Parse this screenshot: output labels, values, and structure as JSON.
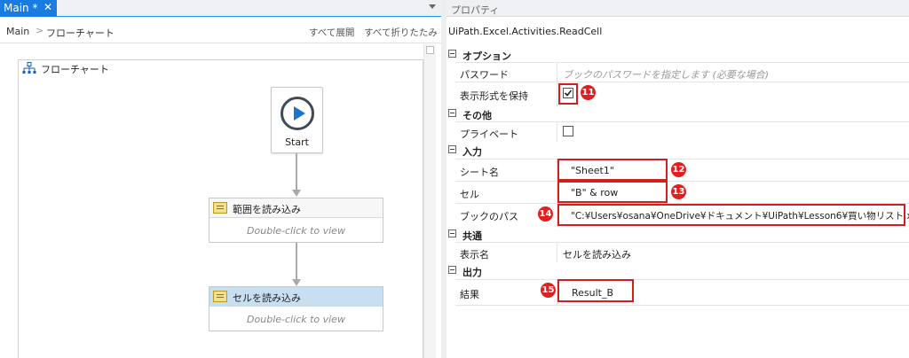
{
  "designer": {
    "tab_label": "Main *",
    "tab_close": "✕",
    "breadcrumb": {
      "main": "Main",
      "separator": ">",
      "current": "フローチャート"
    },
    "expand_all": "すべて展開",
    "collapse_all": "すべて折りたたみ",
    "flowchart_title": "フローチャート",
    "start_label": "Start",
    "activities": [
      {
        "title": "範囲を読み込み",
        "body": "Double-click to view"
      },
      {
        "title": "セルを読み込み",
        "body": "Double-click to view"
      }
    ]
  },
  "properties": {
    "panel_title": "プロパティ",
    "activity_type": "UiPath.Excel.Activities.ReadCell",
    "categories": [
      {
        "label": "オプション"
      },
      {
        "label": "その他"
      },
      {
        "label": "入力"
      },
      {
        "label": "共通"
      },
      {
        "label": "出力"
      }
    ],
    "rows": {
      "password": {
        "name": "パスワード",
        "placeholder": "ブックのパスワードを指定します (必要な場合)"
      },
      "preserve_format": {
        "name": "表示形式を保持",
        "checked": true
      },
      "private": {
        "name": "プライベート",
        "checked": false
      },
      "sheet_name": {
        "name": "シート名",
        "value": "\"Sheet1\""
      },
      "cell": {
        "name": "セル",
        "value": "\"B\" & row"
      },
      "workbook_path": {
        "name": "ブックのパス",
        "value": "\"C:¥Users¥osana¥OneDrive¥ドキュメント¥UiPath¥Lesson6¥買い物リスト.xlsx\""
      },
      "display_name": {
        "name": "表示名",
        "value": "セルを読み込み"
      },
      "result": {
        "name": "結果",
        "value": "Result_B"
      }
    },
    "badges": [
      "11",
      "12",
      "13",
      "14",
      "15"
    ]
  },
  "colors": {
    "accent": "#1a7be0",
    "annotation_red": "#d01f1f",
    "selected_activity": "#c8dff2"
  },
  "icons": [
    "close-icon",
    "chevron-down-icon",
    "flowchart-icon",
    "play-icon",
    "excel-activity-icon",
    "collapse-icon",
    "checkbox-checked",
    "checkbox-empty"
  ]
}
